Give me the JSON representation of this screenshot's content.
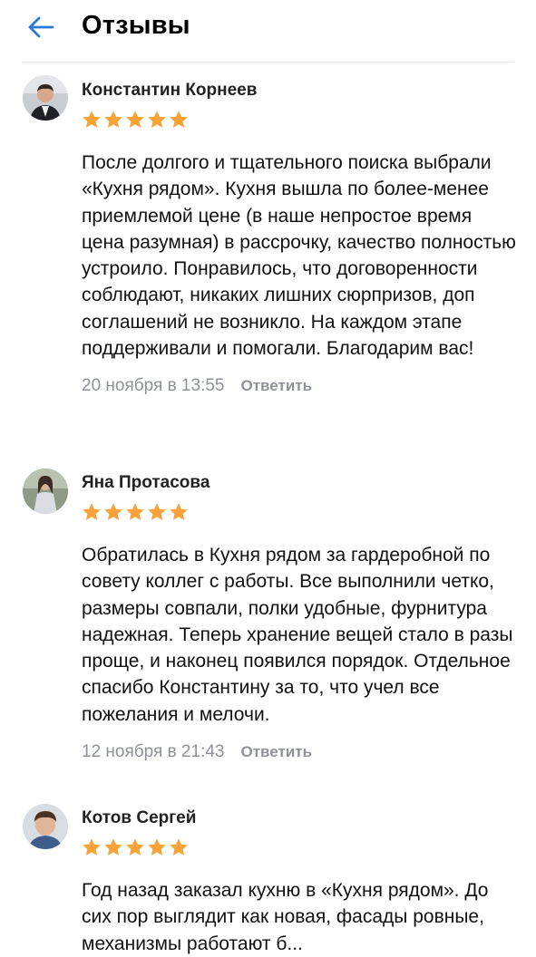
{
  "header": {
    "title": "Отзывы"
  },
  "reviews": [
    {
      "name": "Константин Корнеев",
      "rating": 5,
      "text": "После долгого и тщательного поиска выбрали «Кухня рядом». Кухня вышла по более-менее приемлемой цене (в наше непростое время цена разумная) в рассрочку, качество полностью устроило. Понравилось, что договоренности соблюдают, никаких лишних сюрпризов, доп соглашений не возникло. На каждом этапе поддерживали и помогали. Благодарим вас!",
      "date": "20 ноября в 13:55",
      "reply": "Ответить"
    },
    {
      "name": "Яна Протасова",
      "rating": 5,
      "text": "Обратилась в Кухня рядом за гардеробной по совету коллег с работы. Все выполнили четко, размеры совпали, полки удобные, фурнитура надежная. Теперь хранение вещей стало в разы проще, и наконец появился порядок. Отдельное спасибо Константину за то, что учел все пожелания и мелочи.",
      "date": "12 ноября в 21:43",
      "reply": "Ответить"
    },
    {
      "name": "Котов Сергей",
      "rating": 5,
      "text": "Год назад заказал кухню в «Кухня рядом». До сих пор выглядит как новая, фасады ровные, механизмы работают б...",
      "date": "",
      "reply": ""
    }
  ],
  "colors": {
    "star": "#f8a33a",
    "meta": "#8e9298",
    "accent": "#2b7ad4"
  }
}
